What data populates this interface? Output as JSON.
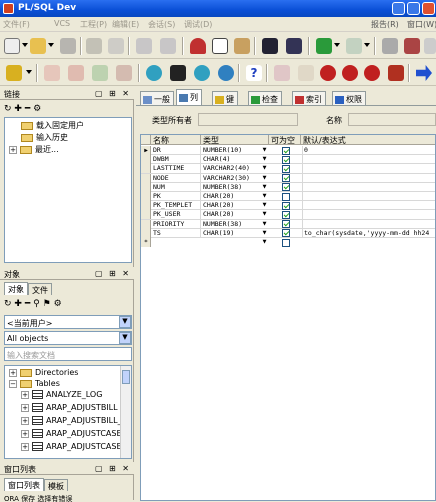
{
  "window": {
    "title": "PL/SQL Dev"
  },
  "menu": {
    "items": [
      "文件(F)",
      "VCS",
      "工程(P)",
      "编辑(E)",
      "会话(S)",
      "调试(D)"
    ],
    "right": [
      "报告(R)",
      "窗口(W)"
    ]
  },
  "left_panel": {
    "title": "链接",
    "tree": [
      "载入固定用户",
      "输入历史",
      "最近..."
    ]
  },
  "objects_panel": {
    "title": "对象",
    "tabs": [
      "对象",
      "文件"
    ],
    "user_select": "<当前用户>",
    "scope_select": "All objects",
    "search_placeholder": "输入搜索文档",
    "tree": [
      "Directories",
      "Tables",
      "ANALYZE_LOG",
      "ARAP_ADJUSTBILL",
      "ARAP_ADJUSTBILL_I",
      "ARAP_ADJUSTCASE",
      "ARAP_ADJUSTCASE_I"
    ]
  },
  "window_list": {
    "title": "窗口列表",
    "tabs": [
      "窗口列表",
      "模板"
    ],
    "partial": "ORA 保存 选择有错误"
  },
  "editor": {
    "tabs": [
      "一般",
      "列",
      "键",
      "检查",
      "索引",
      "权限"
    ],
    "active_tab": "列",
    "type_owner_label": "类型所有者",
    "name_label": "名称",
    "columns_header": [
      "名称",
      "类型",
      "可为空",
      "默认/表达式"
    ],
    "rows": [
      {
        "name": "DR",
        "type": "NUMBER(10)",
        "nullable": true,
        "default": "0",
        "current": true
      },
      {
        "name": "DWBM",
        "type": "CHAR(4)",
        "nullable": true,
        "default": ""
      },
      {
        "name": "LASTTIME",
        "type": "VARCHAR2(40)",
        "nullable": true,
        "default": ""
      },
      {
        "name": "NODE",
        "type": "VARCHAR2(30)",
        "nullable": true,
        "default": ""
      },
      {
        "name": "NUM",
        "type": "NUMBER(38)",
        "nullable": true,
        "default": ""
      },
      {
        "name": "PK",
        "type": "CHAR(20)",
        "nullable": false,
        "default": ""
      },
      {
        "name": "PK_TEMPLET",
        "type": "CHAR(20)",
        "nullable": true,
        "default": ""
      },
      {
        "name": "PK_USER",
        "type": "CHAR(20)",
        "nullable": true,
        "default": ""
      },
      {
        "name": "PRIORITY",
        "type": "NUMBER(38)",
        "nullable": true,
        "default": ""
      },
      {
        "name": "TS",
        "type": "CHAR(19)",
        "nullable": true,
        "default": "to_char(sysdate,'yyyy-mm-dd hh24"
      }
    ],
    "new_row_marker": "*"
  }
}
